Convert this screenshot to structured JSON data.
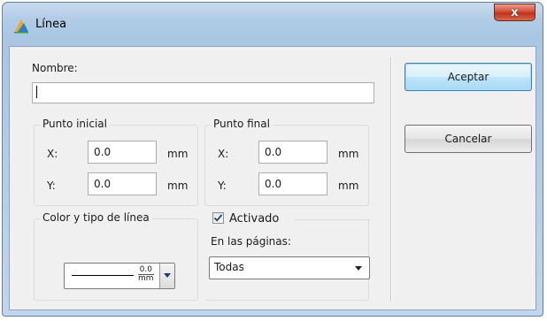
{
  "window": {
    "title": "Línea",
    "close_glyph": "x"
  },
  "form": {
    "nombre_label": "Nombre:",
    "nombre_value": "",
    "punto_inicial": {
      "legend": "Punto inicial",
      "x_label": "X:",
      "x_value": "0.0",
      "y_label": "Y:",
      "y_value": "0.0",
      "unit": "mm"
    },
    "punto_final": {
      "legend": "Punto final",
      "x_label": "X:",
      "x_value": "0.0",
      "y_label": "Y:",
      "y_value": "0.0",
      "unit": "mm"
    },
    "color_linea": {
      "legend": "Color y tipo de línea",
      "width_value": "0.0",
      "width_unit": "mm"
    },
    "activado": {
      "label": "Activado",
      "checked": true
    },
    "paginas": {
      "label": "En las páginas:",
      "selected": "Todas"
    }
  },
  "buttons": {
    "accept": "Aceptar",
    "cancel": "Cancelar"
  },
  "icons": {
    "app": "app-icon",
    "close": "close-icon",
    "check": "check-icon",
    "dropdown": "chevron-down-icon"
  },
  "colors": {
    "accent": "#3c7fb1",
    "titlebar": "#b3cde7",
    "close": "#c0311c"
  }
}
